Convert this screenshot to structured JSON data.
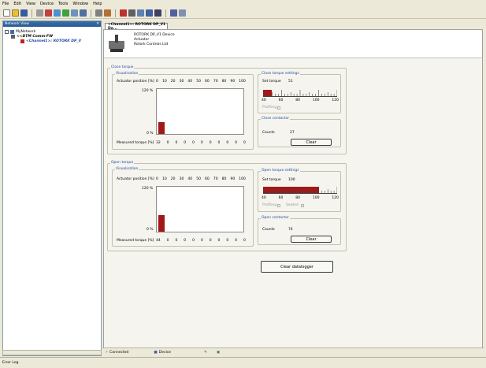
{
  "menu": [
    "File",
    "Edit",
    "View",
    "Device",
    "Tools",
    "Window",
    "Help"
  ],
  "toolbar_icons": [
    "new-icon",
    "open-icon",
    "save-icon",
    "print-icon",
    "cut-icon",
    "copy-icon",
    "paste-icon",
    "zoom-icon",
    "zoom-out-icon",
    "grid-icon",
    "network-icon",
    "connect-icon",
    "disconnect-icon",
    "settings-icon",
    "upload-icon",
    "download-icon",
    "help-icon",
    "about-icon"
  ],
  "network_view": {
    "title": "Network View",
    "tree": [
      {
        "label": "MyNetwork",
        "indent": 0
      },
      {
        "label": "<<DTM Comm-FW",
        "indent": 1
      },
      {
        "label": "<Channel1>: ROTORK DP_V",
        "indent": 2
      }
    ]
  },
  "tab": {
    "label": "<Channel1>: ROTORK DP_V1 De..."
  },
  "device": {
    "line1": "ROTORK DP_V1 Device",
    "line2": "Actuator",
    "line3": "Rotork Controls Ltd"
  },
  "close_torque": {
    "title": "Close torque",
    "vis_title": "Visualisation",
    "pos_label": "Actuator position [%]",
    "positions": [
      "0",
      "10",
      "20",
      "30",
      "40",
      "50",
      "60",
      "70",
      "80",
      "90",
      "100"
    ],
    "ymax": "120 %",
    "ymin": "0 %",
    "measured_label": "Measured torque [%]",
    "measured": [
      "32",
      "0",
      "0",
      "0",
      "0",
      "0",
      "0",
      "0",
      "0",
      "0",
      "0"
    ],
    "bar_fraction": 0.27,
    "settings_title": "Close torque settings",
    "set_label": "Set torque",
    "set_value": "51",
    "set_fraction": 0.12,
    "scale": [
      "40",
      "60",
      "80",
      "100",
      "120"
    ],
    "opt_label": "Profiling",
    "counter_title": "Close contactor",
    "counts_label": "Counts",
    "counts": "27",
    "clear_label": "Clear"
  },
  "open_torque": {
    "title": "Open torque",
    "vis_title": "Visualisation",
    "pos_label": "Actuator position [%]",
    "positions": [
      "0",
      "10",
      "20",
      "30",
      "40",
      "50",
      "60",
      "70",
      "80",
      "90",
      "100"
    ],
    "ymax": "120 %",
    "ymin": "0 %",
    "measured_label": "Measured torque [%]",
    "measured": [
      "44",
      "0",
      "0",
      "0",
      "0",
      "0",
      "0",
      "0",
      "0",
      "0",
      "0"
    ],
    "bar_fraction": 0.37,
    "settings_title": "Open torque settings",
    "set_label": "Set torque",
    "set_value": "100",
    "set_fraction": 0.75,
    "scale": [
      "40",
      "60",
      "80",
      "100",
      "120"
    ],
    "opt_label": "Profiling",
    "opt2_label": "Seated",
    "counter_title": "Open contactor",
    "counts_label": "Counts",
    "counts": "74",
    "clear_label": "Clear"
  },
  "datalogger_button": "Clear datalogger",
  "status": {
    "connected": "Connected",
    "device": "Device"
  },
  "error_log": "Error Log",
  "colors": {
    "accent": "#a01818",
    "group_title": "#1f4fa0",
    "panel_header": "#2a5a95"
  }
}
